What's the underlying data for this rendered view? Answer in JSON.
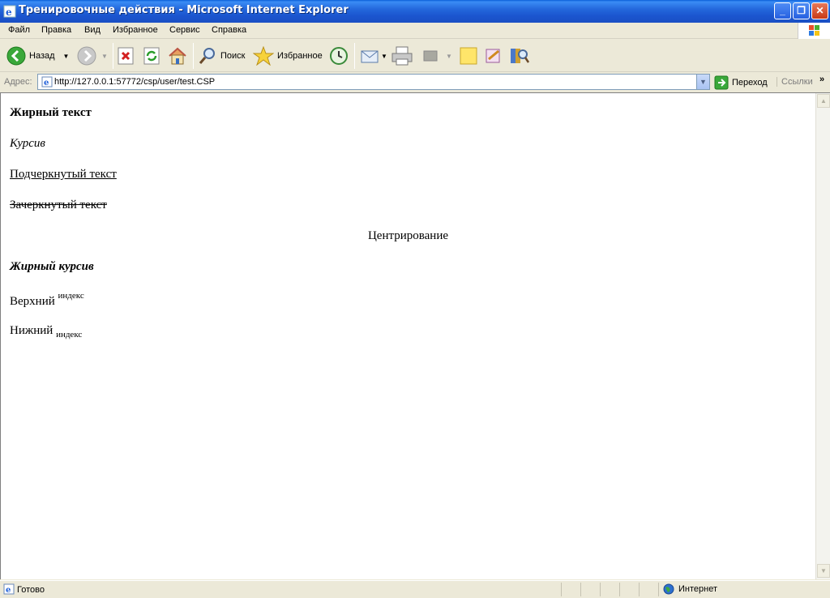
{
  "window": {
    "title": "Тренировочные действия - Microsoft Internet Explorer"
  },
  "menu": [
    "Файл",
    "Правка",
    "Вид",
    "Избранное",
    "Сервис",
    "Справка"
  ],
  "toolbar": {
    "back_label": "Назад",
    "search_label": "Поиск",
    "favorites_label": "Избранное"
  },
  "address": {
    "label": "Адрес:",
    "url": "http://127.0.0.1:57772/csp/user/test.CSP",
    "go_label": "Переход",
    "links_label": "Ссылки",
    "links_more": "»"
  },
  "content": {
    "bold": "Жирный текст",
    "italic": "Курсив",
    "underline": "Подчеркнутый текст",
    "strike": "Зачеркнутый текст",
    "center": "Центрирование",
    "bold_italic": "Жирный курсив",
    "sup_base": "Верхний",
    "sup_index": "индекс",
    "sub_base": "Нижний",
    "sub_index": "индекс"
  },
  "status": {
    "text": "Готово",
    "zone": "Интернет"
  }
}
